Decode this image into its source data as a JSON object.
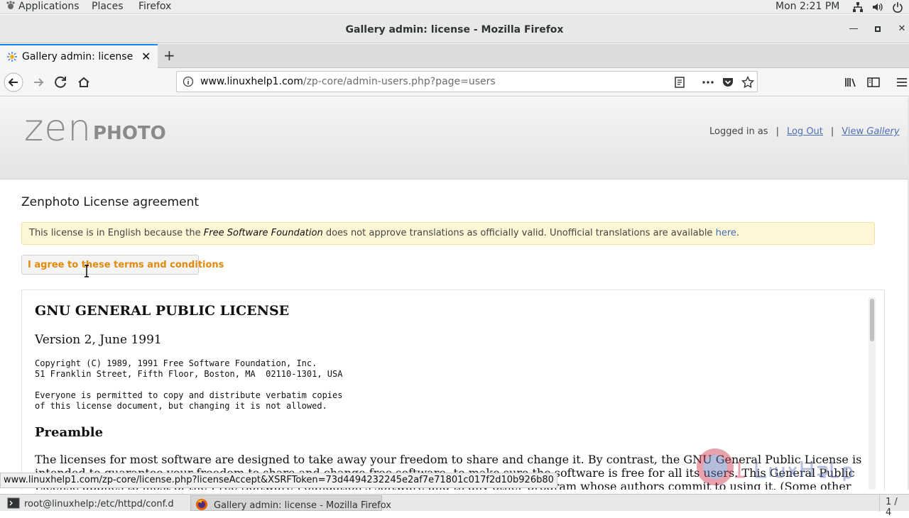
{
  "top_bar": {
    "applications": "Applications",
    "places": "Places",
    "firefox": "Firefox",
    "clock": "Mon  2:21 PM",
    "icons": [
      "network-icon",
      "volume-icon",
      "power-icon"
    ]
  },
  "window": {
    "title": "Gallery admin: license - Mozilla Firefox"
  },
  "tab": {
    "label": "Gallery admin: license"
  },
  "urlbar": {
    "host": "www.linuxhelp1.com",
    "path": "/zp-core/admin-users.php?page=users"
  },
  "header": {
    "logo_zen": "zen",
    "logo_photo": "PHOTO",
    "logged_in": "Logged in as",
    "sep1": "|",
    "logout": "Log Out",
    "sep2": "|",
    "view": "View ",
    "gallery": "Gallery"
  },
  "main": {
    "title": "Zenphoto License agreement",
    "notice_pre": "This license is in English because the ",
    "notice_fsf": "Free Software Foundation",
    "notice_mid": " does not approve translations as officially valid. Unofficial translations are available ",
    "notice_link": "here",
    "notice_end": ".",
    "agree_button": "I agree to these terms and conditions"
  },
  "license": {
    "heading": "GNU GENERAL PUBLIC LICENSE",
    "version": "Version 2, June 1991",
    "copyright": "Copyright (C) 1989, 1991 Free Software Foundation, Inc.\n51 Franklin Street, Fifth Floor, Boston, MA  02110-1301, USA",
    "permission": "Everyone is permitted to copy and distribute verbatim copies\nof this license document, but changing it is not allowed.",
    "preamble": "Preamble",
    "paragraph": "The licenses for most software are designed to take away your freedom to share and change it. By contrast, the GNU General Public License is intended to guarantee your freedom to share and change free software--to make sure the software is free for all its users. This General Public License applies to most of the Free Software Foundation's software and to any other program whose authors commit to using it. (Some other"
  },
  "status_url": "www.linuxhelp1.com/zp-core/license.php?licenseAccept&XSRFToken=73d4494232245e2af7e71801c017f2d10b926b80",
  "taskbar": {
    "terminal": "root@linuxhelp:/etc/httpd/conf.d",
    "firefox": "Gallery admin: license - Mozilla Firefox",
    "pager": "1 / 4"
  },
  "colors": {
    "accent_tab": "#0a84ff",
    "agree_text": "#e08a0a",
    "notice_bg": "#fff6d6",
    "link": "#4d70b5"
  }
}
